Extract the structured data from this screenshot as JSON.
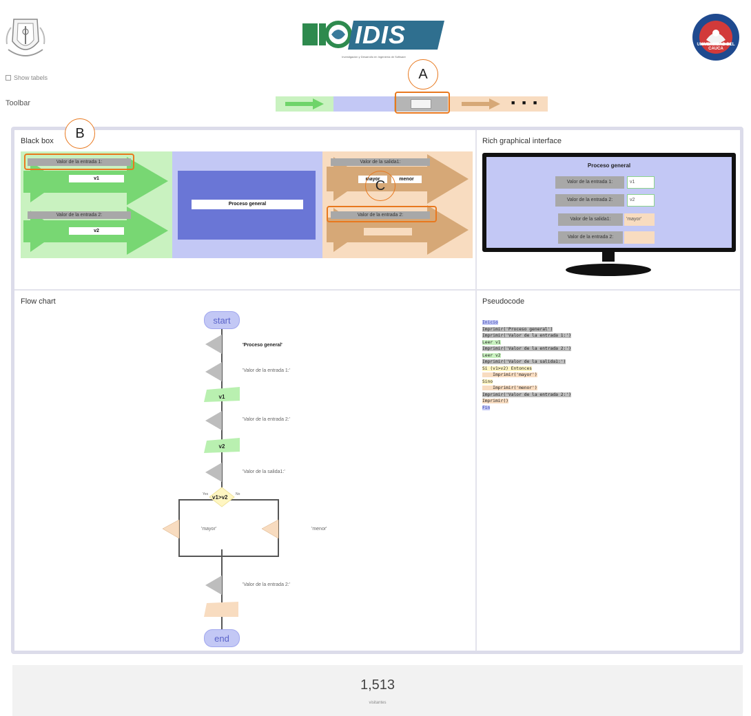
{
  "header": {
    "show_tabs_label": "Show tabels",
    "logo_brand": "IDIS",
    "logo_tagline": "Investigación y Desarrollo en Ingeniería de Software",
    "right_seal_text": "UNIVERSIDAD DEL CAUCA"
  },
  "toolbar": {
    "label": "Toolbar",
    "more": "■ ■ ■"
  },
  "callouts": {
    "a": "A",
    "b": "B",
    "c": "C"
  },
  "black_box": {
    "title": "Black box",
    "inputs": [
      {
        "label": "Valor de la entrada 1:",
        "var": "v1"
      },
      {
        "label": "Valor de la entrada 2:",
        "var": "v2"
      }
    ],
    "process": "Proceso general",
    "outputs": [
      {
        "label": "Valor de la salida1:",
        "values": [
          "mayor",
          "menor"
        ]
      },
      {
        "label": "Valor de la entrada 2:",
        "values": []
      }
    ]
  },
  "rich_gui": {
    "title": "Rich graphical interface",
    "header": "Proceso general",
    "rows": [
      {
        "label": "Valor de la entrada 1:",
        "value": "v1"
      },
      {
        "label": "Valor de la entrada 2:",
        "value": "v2"
      },
      {
        "label": "Valor de la salida1:",
        "value": "'mayor'"
      },
      {
        "label": "Valor de la entrada 2:",
        "value": ""
      }
    ]
  },
  "flow_chart": {
    "title": "Flow chart",
    "start": "start",
    "end": "end",
    "outputs": [
      "'Proceso general'",
      "'Valor de la entrada 1:'",
      "'Valor de la entrada 2:'",
      "'Valor de la salida1:'",
      "'Valor de la entrada 2:'"
    ],
    "inputs": [
      "v1",
      "v2"
    ],
    "decision": "v1>v2",
    "yes_label": "Yes",
    "no_label": "No",
    "branch_outputs": [
      "'mayor'",
      "'menor'"
    ]
  },
  "pseudocode": {
    "title": "Pseudocode",
    "lines": [
      "Inicio",
      "Imprimir('Proceso general')",
      "Imprimir('Valor de la entrada 1:')",
      "Leer v1",
      "Imprimir('Valor de la entrada 2:')",
      "Leer v2",
      "Imprimir('Valor de la salida1:')",
      "Si (v1>v2) Entonces",
      "    Imprimir('mayor')",
      "Sino",
      "    Imprimir('menor')",
      "Imprimir('Valor de la entrada 2:')",
      "Imprimir()",
      "Fin"
    ]
  },
  "footer": {
    "count": "1,513",
    "label": "visitantes"
  },
  "colors": {
    "green": "#c9f2c0",
    "blue": "#c3c8f5",
    "orange": "#f8dcc0",
    "gray": "#a8a8a8",
    "accent": "#e8781e"
  }
}
